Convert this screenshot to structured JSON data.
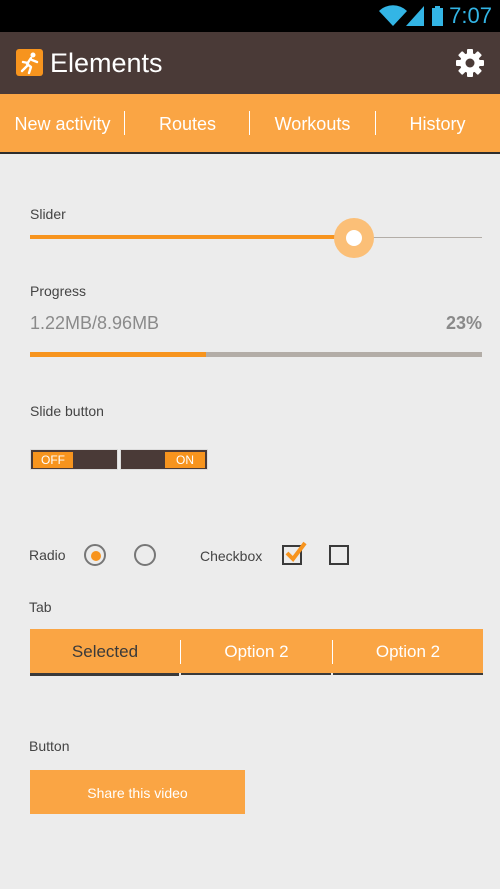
{
  "status_bar": {
    "time": "7:07",
    "icons": [
      "wifi-icon",
      "signal-icon",
      "battery-icon"
    ]
  },
  "action_bar": {
    "title": "Elements",
    "app_icon": "running-person-icon",
    "settings_icon": "gear-icon"
  },
  "tabs": [
    {
      "label": "New activity"
    },
    {
      "label": "Routes"
    },
    {
      "label": "Workouts"
    },
    {
      "label": "History"
    }
  ],
  "slider": {
    "label": "Slider",
    "value_fraction": 0.72
  },
  "progress": {
    "label": "Progress",
    "text": "1.22MB/8.96MB",
    "percent_text": "23%",
    "value_fraction": 0.39
  },
  "slide_button": {
    "label": "Slide button",
    "switches": [
      {
        "label": "OFF",
        "state": "off"
      },
      {
        "label": "ON",
        "state": "on"
      }
    ]
  },
  "radio": {
    "label": "Radio",
    "options": [
      {
        "checked": true
      },
      {
        "checked": false
      }
    ]
  },
  "checkbox": {
    "label": "Checkbox",
    "options": [
      {
        "checked": true
      },
      {
        "checked": false
      }
    ]
  },
  "tab_control": {
    "label": "Tab",
    "options": [
      "Selected",
      "Option 2",
      "Option 2"
    ],
    "selected_index": 0
  },
  "button": {
    "label": "Button",
    "text": "Share this video"
  },
  "colors": {
    "accent": "#f7941e",
    "accent_light": "#faa544",
    "bar_dark": "#4a3a37",
    "background": "#ececec"
  }
}
